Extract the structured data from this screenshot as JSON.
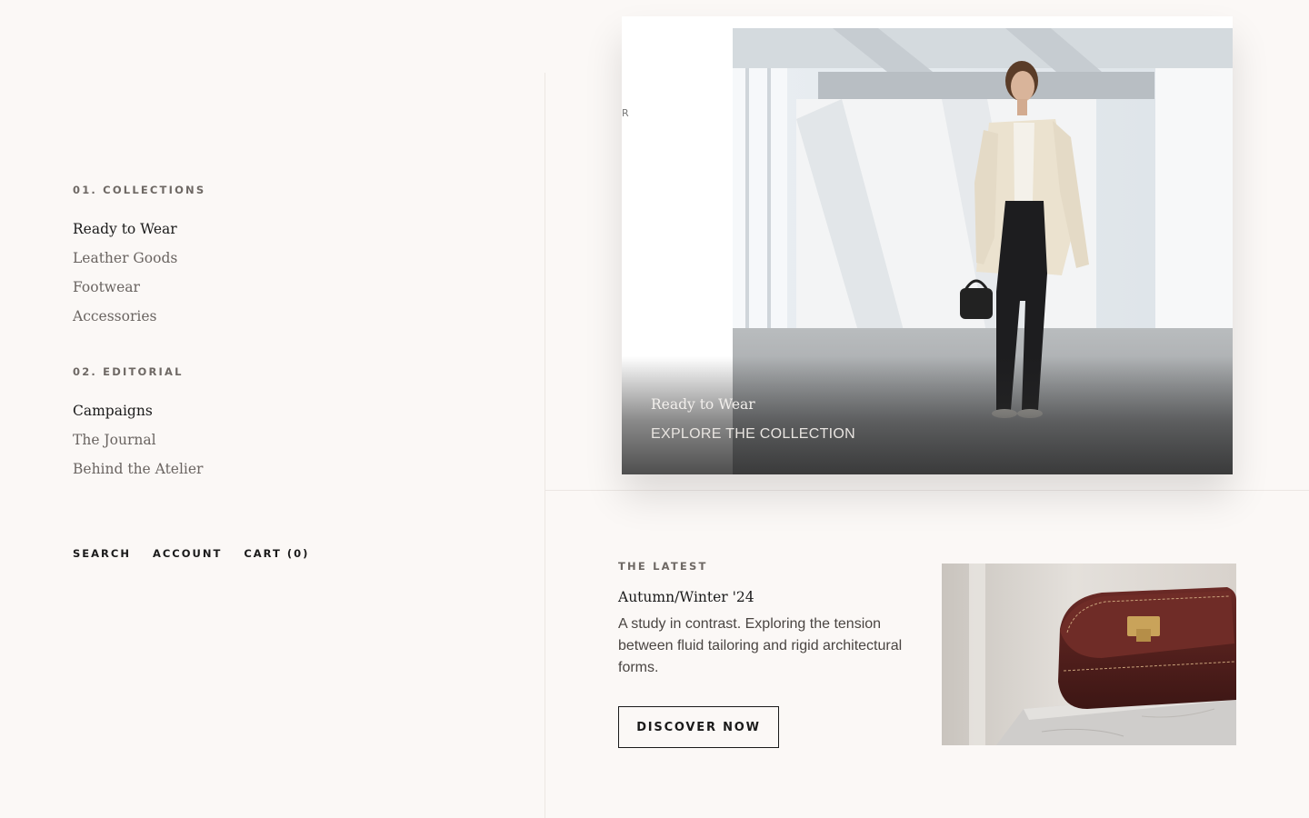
{
  "nav": {
    "collections": {
      "heading": "01. COLLECTIONS",
      "items": [
        "Ready to Wear",
        "Leather Goods",
        "Footwear",
        "Accessories"
      ]
    },
    "editorial": {
      "heading": "02. EDITORIAL",
      "items": [
        "Campaigns",
        "The Journal",
        "Behind the Atelier"
      ]
    },
    "utility": {
      "search": "SEARCH",
      "account": "ACCOUNT",
      "cart": "CART (0)"
    }
  },
  "hero": {
    "title": "Ready to Wear",
    "cta": "EXPLORE THE COLLECTION"
  },
  "latest": {
    "eyebrow": "THE LATEST",
    "title": "Autumn/Winter '24",
    "body": "A study in contrast. Exploring the tension between fluid tailoring and rigid architectural forms.",
    "button": "DISCOVER NOW"
  },
  "colors": {
    "background": "#fbf8f6",
    "text": "#1a1a1a",
    "muted": "#6e6864"
  }
}
